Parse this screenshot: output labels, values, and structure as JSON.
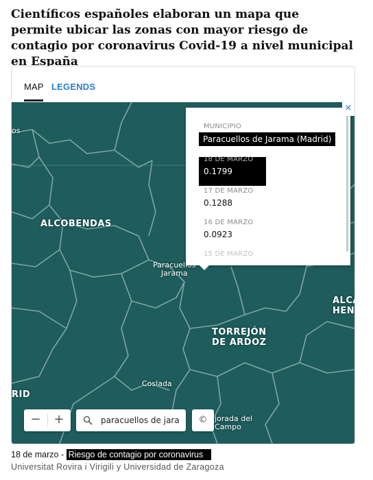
{
  "headline": "Científicos españoles elaboran un mapa que permite ubicar las zonas con mayor riesgo de contagio por coronavirus Covid-19 a nivel municipal en España",
  "tabs": [
    {
      "label": "MAP",
      "active": true
    },
    {
      "label": "LEGENDS",
      "active": false
    }
  ],
  "map": {
    "places": {
      "partial_os": "os",
      "alcobendas": "ALCOBENDAS",
      "paracuellos_line1": "Paracuellos",
      "paracuellos_line2": "Jarama",
      "torrejon_line1": "TORREJÓN",
      "torrejon_line2": "DE ARDOZ",
      "alca_line1": "ALCA",
      "alca_line2": "HEN",
      "coslada": "Coslada",
      "rid": "RID",
      "loeches_line1": "jorada del",
      "loeches_line2": "Campo"
    },
    "popup": {
      "municipio_label": "MUNICIPIO",
      "municipio_value": "Paracuellos de Jarama (Madrid)",
      "entries": [
        {
          "date": "18 DE MARZO",
          "value": "0.1799",
          "highlight": true
        },
        {
          "date": "17 DE MARZO",
          "value": "0.1288",
          "highlight": false
        },
        {
          "date": "16 DE MARZO",
          "value": "0.0923",
          "highlight": false
        },
        {
          "date": "15 DE MARZO",
          "value": "",
          "highlight": false
        }
      ],
      "close_symbol": "×"
    },
    "controls": {
      "zoom_out": "−",
      "zoom_in": "+",
      "search_value": "paracuellos de jara",
      "attribution": "©"
    },
    "colors": {
      "fill": "#1f5c5c",
      "border": "#8fb3b3",
      "accent": "#2b7bd1"
    }
  },
  "footer": {
    "date": "18 de marzo - ",
    "highlight": "Riesgo de contagio por coronavirus",
    "source": "Universitat Rovira i Virigili y Universidad de Zaragoza"
  }
}
